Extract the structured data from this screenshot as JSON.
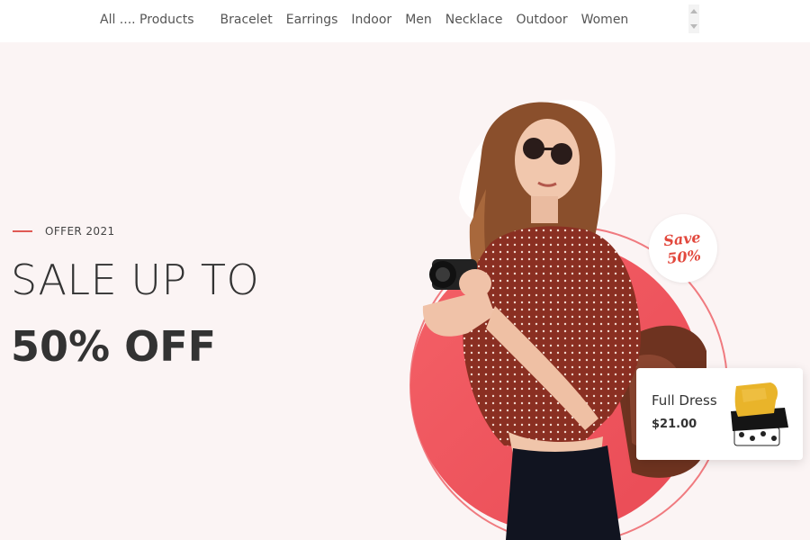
{
  "nav": {
    "items": [
      {
        "label": "All .... Products"
      },
      {
        "label": "Bracelet"
      },
      {
        "label": "Earrings"
      },
      {
        "label": "Indoor"
      },
      {
        "label": "Men"
      },
      {
        "label": "Necklace"
      },
      {
        "label": "Outdoor"
      },
      {
        "label": "Women"
      }
    ]
  },
  "hero": {
    "offer_label": "OFFER 2021",
    "headline_line1": "SALE UP TO",
    "headline_line2": "50% OFF"
  },
  "badge": {
    "line1": "Save",
    "line2": "50%"
  },
  "product_card": {
    "name": "Full Dress",
    "price": "$21.00"
  },
  "colors": {
    "accent": "#e05a55",
    "circle": "#ef5a5f",
    "background": "#fbf4f4",
    "text": "#333333"
  },
  "icons": {
    "scroll_up": "caret-up-icon",
    "scroll_down": "caret-down-icon"
  }
}
